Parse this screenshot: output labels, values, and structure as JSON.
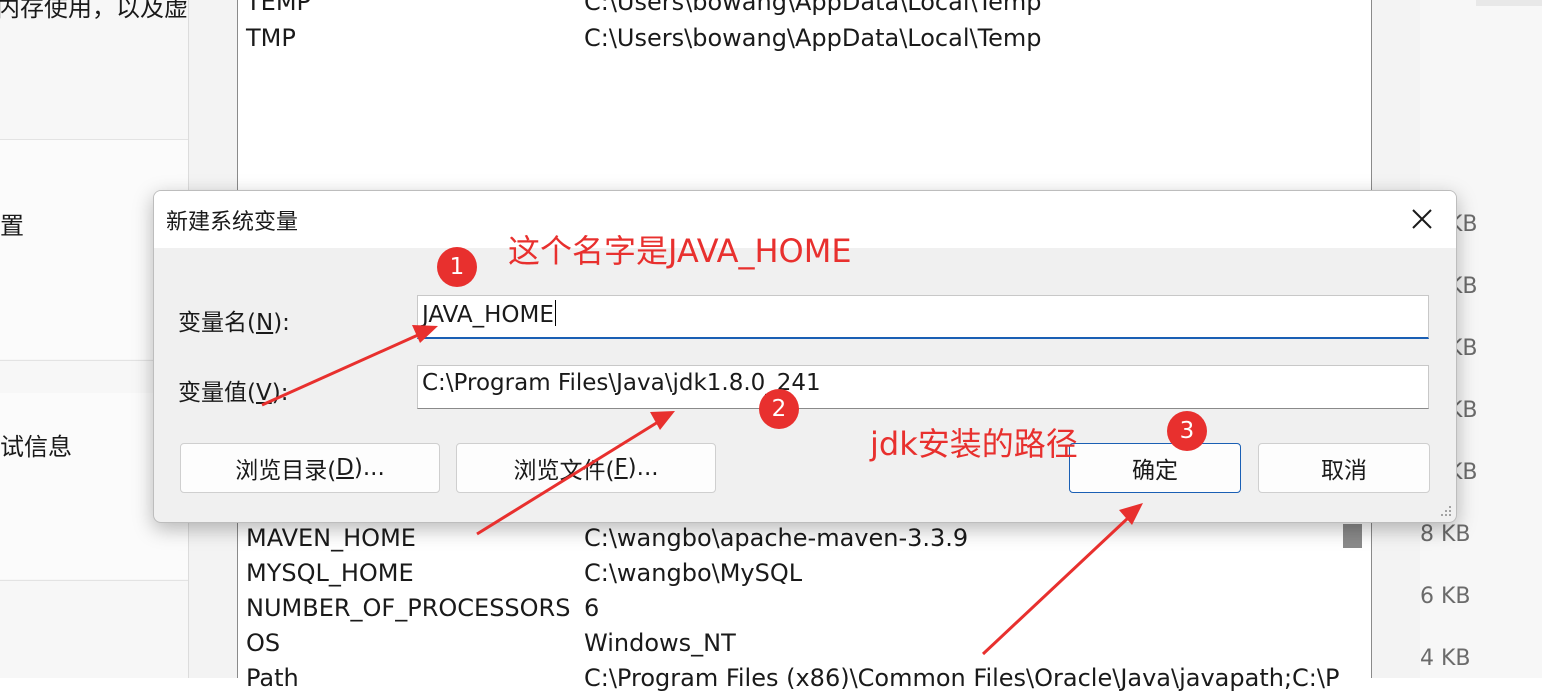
{
  "left_panel": {
    "line_top": "内存使用，以及虚",
    "item_1": "置",
    "item_2": "试信息"
  },
  "env_list_top": [
    {
      "name": "TEMP",
      "value": "C:\\Users\\bowang\\AppData\\Local\\Temp"
    },
    {
      "name": "TMP",
      "value": "C:\\Users\\bowang\\AppData\\Local\\Temp"
    }
  ],
  "env_list_bottom": [
    {
      "name": "MAVEN_HOME",
      "value": "C:\\wangbo\\apache-maven-3.3.9"
    },
    {
      "name": "MYSQL_HOME",
      "value": "C:\\wangbo\\MySQL"
    },
    {
      "name": "NUMBER_OF_PROCESSORS",
      "value": "6"
    },
    {
      "name": "OS",
      "value": "Windows_NT"
    },
    {
      "name": "Path",
      "value": "C:\\Program Files (x86)\\Common Files\\Oracle\\Java\\javapath;C:\\P"
    }
  ],
  "right_sizes": [
    "KB",
    "KB",
    "KB",
    "KB",
    "KB",
    "8 KB",
    "6 KB",
    "4 KB"
  ],
  "dialog": {
    "title": "新建系统变量",
    "name_label": "变量名(",
    "name_accel": "N",
    "name_label_end": "):",
    "name_value": "JAVA_HOME",
    "value_label": "变量值(",
    "value_accel": "V",
    "value_label_end": "):",
    "value_value": "C:\\Program Files\\Java\\jdk1.8.0_241",
    "browse_dir_pre": "浏览目录(",
    "browse_dir_accel": "D",
    "browse_dir_post": ")...",
    "browse_file_pre": "浏览文件(",
    "browse_file_accel": "F",
    "browse_file_post": ")...",
    "ok_label": "确定",
    "cancel_label": "取消"
  },
  "annotations": {
    "note_name": "这个名字是JAVA_HOME",
    "note_path": "jdk安装的路径",
    "badge_1": "1",
    "badge_2": "2",
    "badge_3": "3",
    "color": "#e8302e"
  },
  "icons": {
    "close": "close-icon",
    "resize": "resize-grip-icon"
  },
  "colors": {
    "accent": "#1a5fb4",
    "dialog_bg": "#f0f0f0",
    "annotation": "#e8302e"
  }
}
